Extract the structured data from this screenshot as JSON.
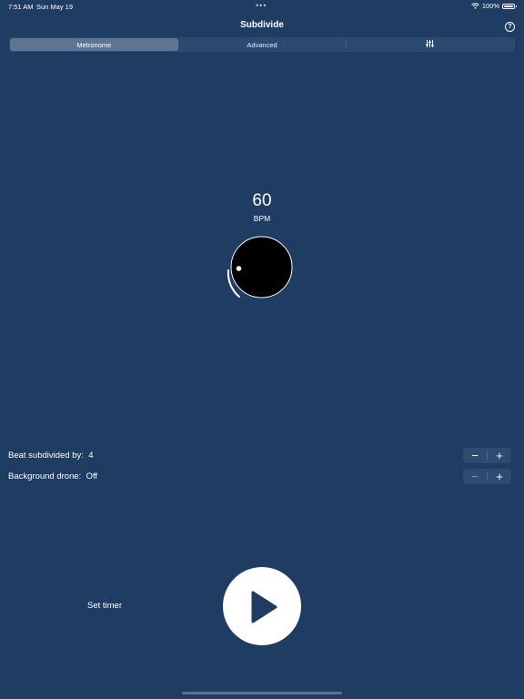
{
  "status_bar": {
    "time": "7:51 AM",
    "date": "Sun May 19",
    "dots": "•••",
    "battery": "100%"
  },
  "header": {
    "title": "Subdivide",
    "help_glyph": "?"
  },
  "tabs": [
    {
      "label": "Metronome",
      "selected": true
    },
    {
      "label": "Advanced",
      "selected": false
    },
    {
      "icon": "sliders-icon",
      "selected": false
    }
  ],
  "tempo": {
    "value": "60",
    "unit": "BPM"
  },
  "settings": {
    "subdivision_label": "Beat subdivided by:",
    "subdivision_value": "4",
    "drone_label": "Background drone:",
    "drone_value": "Off",
    "minus": "−",
    "plus": "+"
  },
  "footer": {
    "set_timer": "Set timer"
  },
  "colors": {
    "background": "#1f3d63",
    "segment_selected": "#5e7594",
    "dial": "#000000",
    "accent": "#ffffff"
  }
}
